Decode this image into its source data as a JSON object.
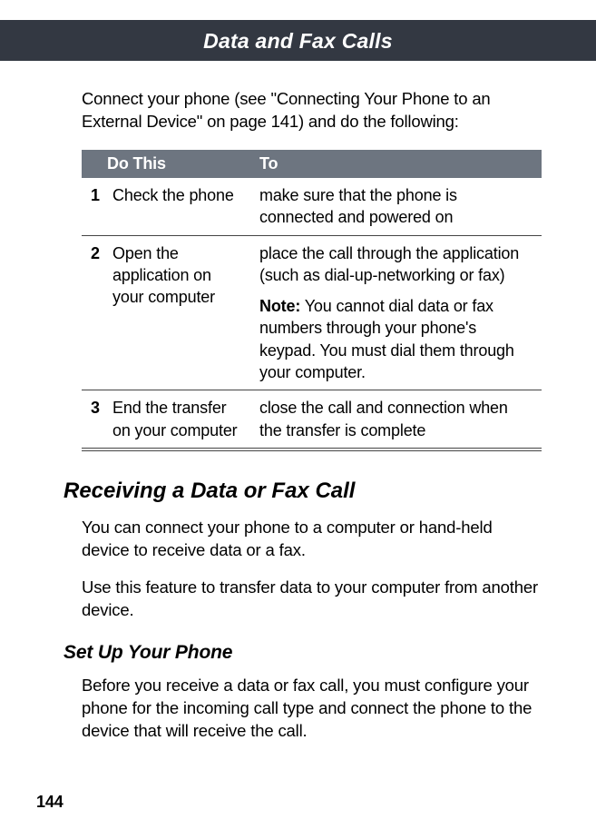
{
  "header": {
    "title": "Data and Fax Calls"
  },
  "intro": "Connect your phone (see \"Connecting Your Phone to an External Device\" on page 141) and do the following:",
  "table": {
    "head_do": "Do This",
    "head_to": "To",
    "rows": [
      {
        "num": "1",
        "do": "Check the phone",
        "to": "make sure that the phone is connected and powered on"
      },
      {
        "num": "2",
        "do": "Open the application on your computer",
        "to": "place the call through the application (such as dial-up-networking or fax)",
        "note_label": "Note:",
        "note": " You cannot dial data or fax numbers through your phone's keypad. You must dial them through your computer."
      },
      {
        "num": "3",
        "do": "End the transfer on your computer",
        "to": "close the call and connection when the transfer is complete"
      }
    ]
  },
  "section_title": "Receiving a Data or Fax Call",
  "section_p1": "You can connect your phone to a computer or hand-held device to receive data or a fax.",
  "section_p2": "Use this feature to transfer data to your computer from another device.",
  "subsection_title": "Set Up Your Phone",
  "subsection_p1": "Before you receive a data or fax call, you must configure your phone for the incoming call type and connect the phone to the device that will receive the call.",
  "page_number": "144"
}
